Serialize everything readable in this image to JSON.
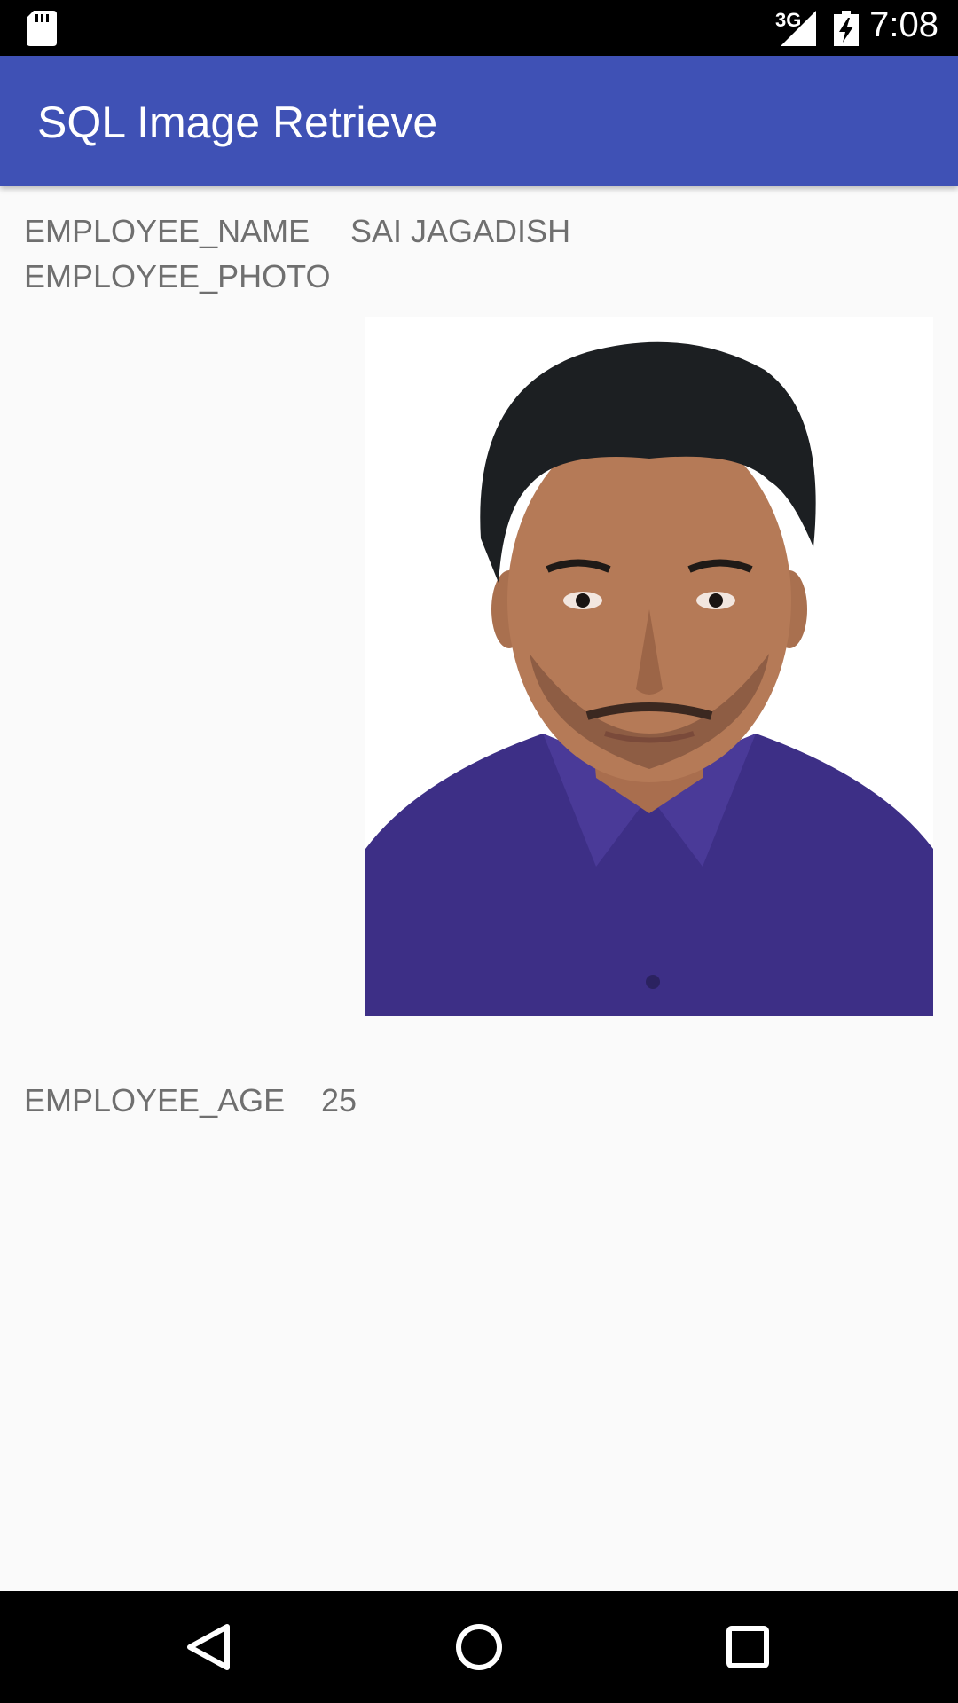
{
  "status_bar": {
    "network": "3G",
    "time": "7:08"
  },
  "app_bar": {
    "title": "SQL Image Retrieve"
  },
  "employee": {
    "name_label": "EMPLOYEE_NAME",
    "name_value": "SAI JAGADISH",
    "photo_label": "EMPLOYEE_PHOTO",
    "age_label": "EMPLOYEE_AGE",
    "age_value": "25"
  },
  "colors": {
    "app_bar": "#3f51b5",
    "background": "#fafafa",
    "field_text": "#6f6f6f"
  },
  "icons": [
    "sd-card-icon",
    "signal-icon",
    "battery-charging-icon",
    "back-icon",
    "home-icon",
    "recents-icon"
  ]
}
